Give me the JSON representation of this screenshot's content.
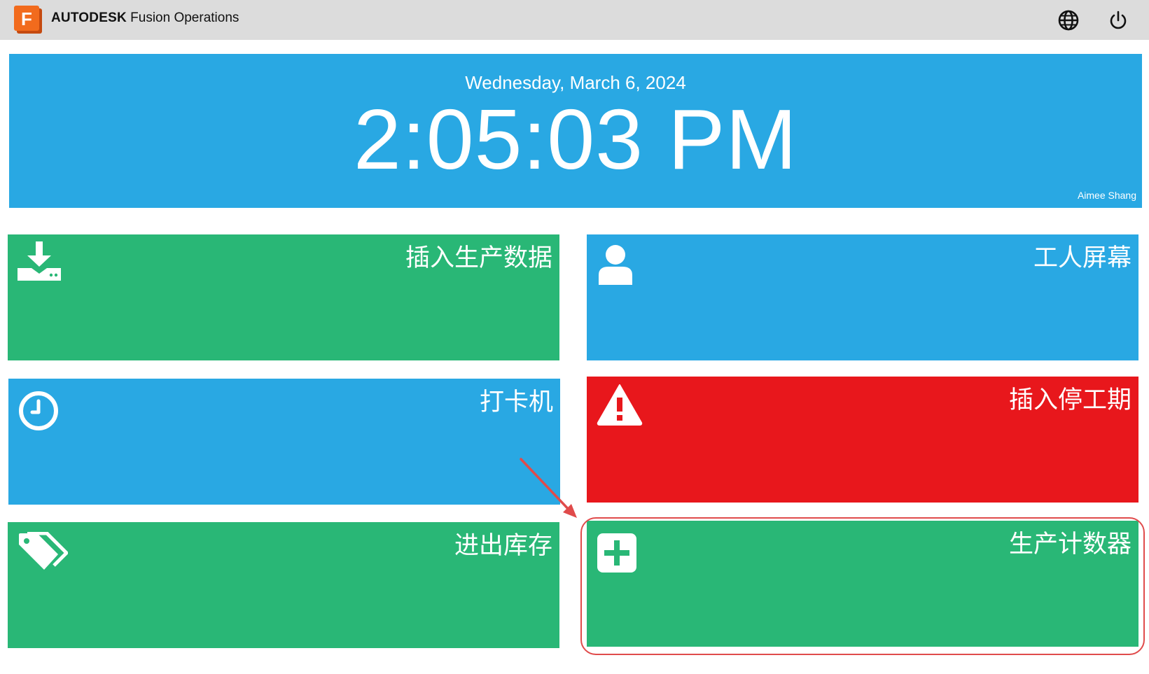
{
  "header": {
    "brand_bold": "AUTODESK",
    "brand_light": "Fusion Operations",
    "logo_letter": "F",
    "icons": [
      "globe-icon",
      "power-icon"
    ]
  },
  "clock": {
    "date": "Wednesday, March 6, 2024",
    "time": "2:05:03 PM",
    "user": "Aimee Shang"
  },
  "tiles": [
    {
      "label": "插入生产数据",
      "icon": "download-tray-icon",
      "color": "#29b776"
    },
    {
      "label": "工人屏幕",
      "icon": "user-icon",
      "color": "#29a8e3"
    },
    {
      "label": "打卡机",
      "icon": "clock-icon",
      "color": "#29a8e3"
    },
    {
      "label": "插入停工期",
      "icon": "warning-icon",
      "color": "#e8171c"
    },
    {
      "label": "进出库存",
      "icon": "tags-icon",
      "color": "#29b776"
    },
    {
      "label": "生产计数器",
      "icon": "plus-square-icon",
      "color": "#29b776"
    }
  ],
  "annotation": {
    "color": "#e04b4b"
  }
}
